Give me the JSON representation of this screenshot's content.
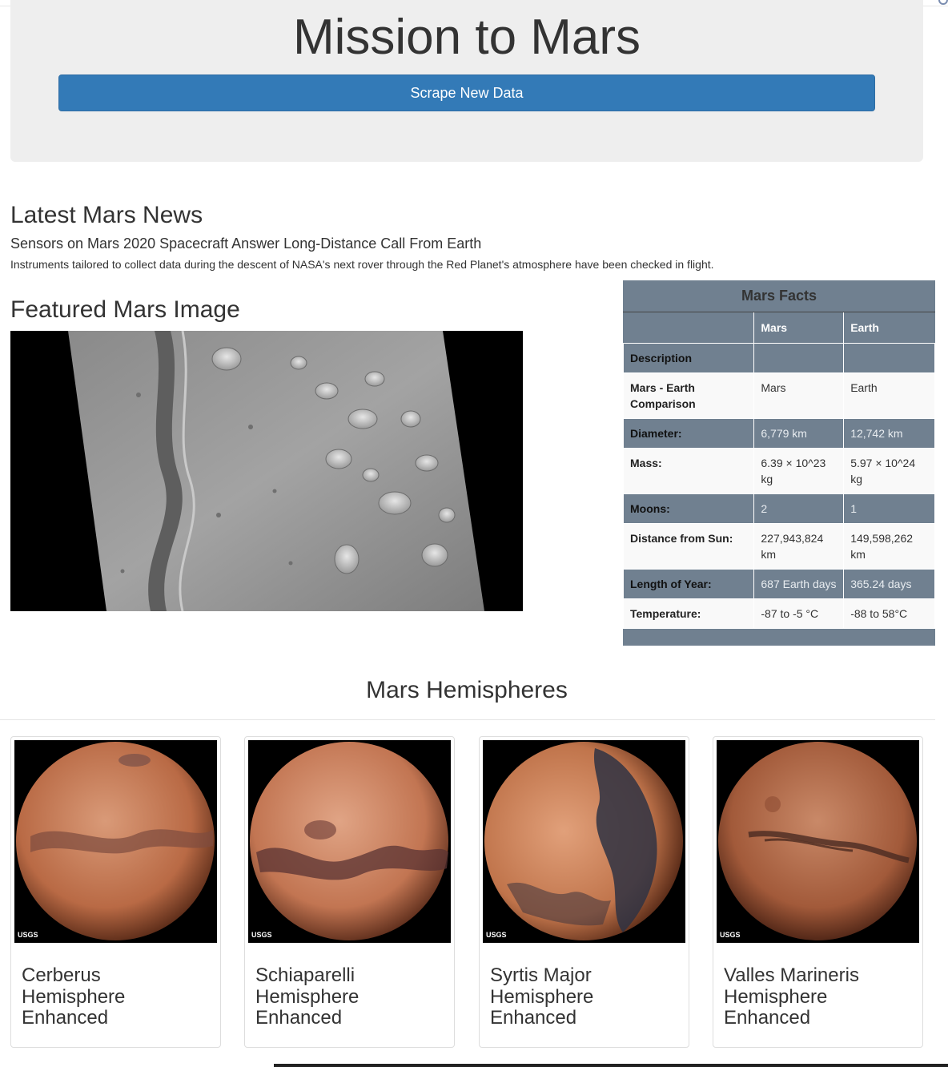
{
  "page": {
    "title": "Mission to Mars",
    "scrape_button": "Scrape New Data"
  },
  "news": {
    "heading": "Latest Mars News",
    "title": "Sensors on Mars 2020 Spacecraft Answer Long-Distance Call From Earth",
    "paragraph": "Instruments tailored to collect data during the descent of NASA's next rover through the Red Planet's atmosphere have been checked in flight."
  },
  "featured": {
    "heading": "Featured Mars Image"
  },
  "facts": {
    "caption": "Mars Facts",
    "columns": [
      "",
      "Mars",
      "Earth"
    ],
    "rows": [
      {
        "label": "Description",
        "mars": "",
        "earth": ""
      },
      {
        "label": "Mars - Earth Comparison",
        "mars": "Mars",
        "earth": "Earth"
      },
      {
        "label": "Diameter:",
        "mars": "6,779 km",
        "earth": "12,742 km"
      },
      {
        "label": "Mass:",
        "mars": "6.39 × 10^23 kg",
        "earth": "5.97 × 10^24 kg"
      },
      {
        "label": "Moons:",
        "mars": "2",
        "earth": "1"
      },
      {
        "label": "Distance from Sun:",
        "mars": "227,943,824 km",
        "earth": "149,598,262 km"
      },
      {
        "label": "Length of Year:",
        "mars": "687 Earth days",
        "earth": "365.24 days"
      },
      {
        "label": "Temperature:",
        "mars": "-87 to -5 °C",
        "earth": "-88 to 58°C"
      }
    ]
  },
  "hemispheres": {
    "heading": "Mars Hemispheres",
    "items": [
      {
        "title": "Cerberus Hemisphere Enhanced",
        "watermark": "USGS"
      },
      {
        "title": "Schiaparelli Hemisphere Enhanced",
        "watermark": "USGS"
      },
      {
        "title": "Syrtis Major Hemisphere Enhanced",
        "watermark": "USGS"
      },
      {
        "title": "Valles Marineris Hemisphere Enhanced",
        "watermark": "USGS"
      }
    ]
  },
  "colors": {
    "button": "#337ab7",
    "jumbotron": "#eeeeee",
    "facts_header": "#708090"
  }
}
